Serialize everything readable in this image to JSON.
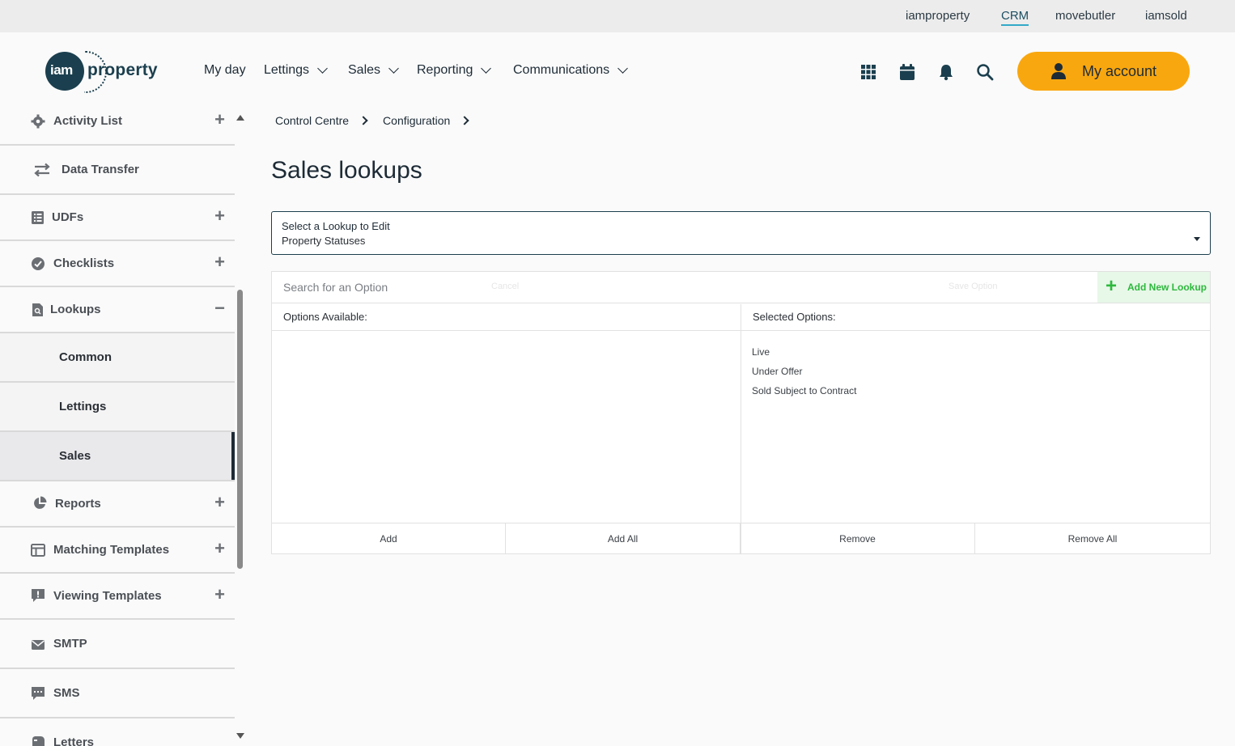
{
  "top_links": [
    {
      "label": "iamproperty",
      "active": false
    },
    {
      "label": "CRM",
      "active": true
    },
    {
      "label": "movebutler",
      "active": false
    },
    {
      "label": "iamsold",
      "active": false
    }
  ],
  "header": {
    "logo_iam": "iam",
    "logo_property": "property",
    "nav": [
      {
        "label": "My day",
        "dropdown": false
      },
      {
        "label": "Lettings",
        "dropdown": true
      },
      {
        "label": "Sales",
        "dropdown": true
      },
      {
        "label": "Reporting",
        "dropdown": true
      },
      {
        "label": "Communications",
        "dropdown": true
      }
    ],
    "icons": [
      "apps-grid-icon",
      "calendar-icon",
      "bell-icon",
      "search-icon"
    ],
    "account_label": "My account",
    "account_color": "#f9a70f"
  },
  "sidebar": {
    "items": [
      {
        "label": "Activity List",
        "icon": "gear-icon",
        "expander": "+"
      },
      {
        "label": "Data Transfer",
        "icon": "transfer-arrows-icon",
        "expander": ""
      },
      {
        "label": "UDFs",
        "icon": "list-icon",
        "expander": "+"
      },
      {
        "label": "Checklists",
        "icon": "check-circle-icon",
        "expander": "+"
      },
      {
        "label": "Lookups",
        "icon": "lookup-document-icon",
        "expander": "−"
      },
      {
        "label": "Common",
        "sub": true
      },
      {
        "label": "Lettings",
        "sub": true
      },
      {
        "label": "Sales",
        "sub": true,
        "active": true
      },
      {
        "label": "Reports",
        "icon": "pie-chart-icon",
        "expander": "+"
      },
      {
        "label": "Matching Templates",
        "icon": "template-icon",
        "expander": "+"
      },
      {
        "label": "Viewing Templates",
        "icon": "comment-alert-icon",
        "expander": "+"
      },
      {
        "label": "SMTP",
        "icon": "envelope-icon",
        "expander": ""
      },
      {
        "label": "SMS",
        "icon": "sms-bubble-icon",
        "expander": ""
      },
      {
        "label": "Letters",
        "icon": "mailbox-icon",
        "expander": ""
      }
    ]
  },
  "breadcrumb": [
    "Control Centre",
    "Configuration"
  ],
  "page_title": "Sales lookups",
  "lookup_select": {
    "label": "Select a Lookup to Edit",
    "value": "Property Statuses"
  },
  "options_panel": {
    "search_placeholder": "Search for an Option",
    "cancel_label": "Cancel",
    "save_label": "Save Option",
    "add_new_lookup_label": "Add New Lookup",
    "available_header": "Options Available:",
    "selected_header": "Selected Options:",
    "available_options": [],
    "selected_options": [
      "Live",
      "Under Offer",
      "Sold Subject to Contract"
    ],
    "buttons": {
      "add": "Add",
      "add_all": "Add All",
      "remove": "Remove",
      "remove_all": "Remove All"
    }
  }
}
